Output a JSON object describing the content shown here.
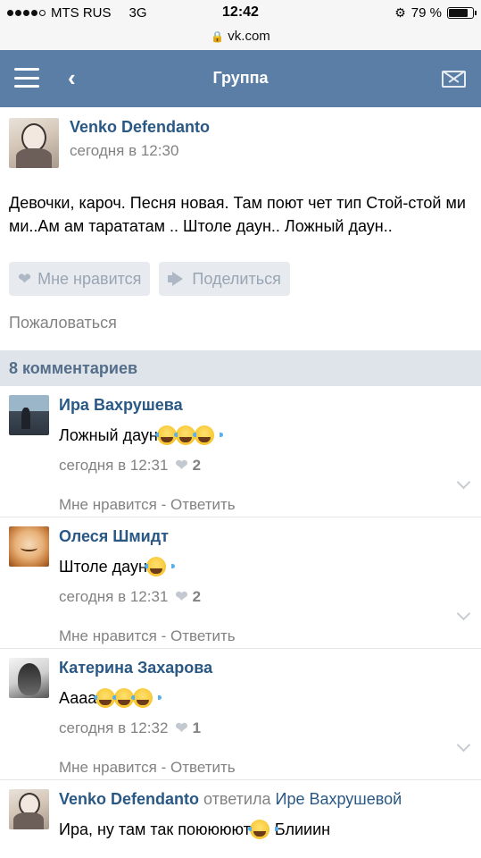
{
  "status_bar": {
    "carrier": "MTS RUS",
    "network": "3G",
    "time": "12:42",
    "battery": "79 %",
    "battery_level": 0.79,
    "url": "vk.com"
  },
  "navbar": {
    "title": "Группа",
    "menu_icon": "hamburger-icon",
    "back_icon": "chevron-left-icon",
    "mail_icon": "envelope-icon",
    "background": "#5b7ea6"
  },
  "post": {
    "author": "Venko Defendanto",
    "time": "сегодня в 12:30",
    "text": "Девочки, кароч. Песня новая. Там поют чет тип Стой-стой ми ми..Ам ам тарататам .. Штоле даун.. Ложный даун..",
    "like_label": "Мне нравится",
    "share_label": "Поделиться",
    "report_label": "Пожаловаться"
  },
  "comments_header": "8 комментариев",
  "comments": [
    {
      "author": "Ира Вахрушева",
      "text": "Ложный даун",
      "emoji_count": 3,
      "time": "сегодня в 12:31",
      "likes": "2",
      "like_label": "Мне нравится",
      "separator": " - ",
      "reply_label": "Ответить"
    },
    {
      "author": "Олеся Шмидт",
      "text": "Штоле даун",
      "emoji_count": 1,
      "time": "сегодня в 12:31",
      "likes": "2",
      "like_label": "Мне нравится",
      "separator": " - ",
      "reply_label": "Ответить"
    },
    {
      "author": "Катерина Захарова",
      "text": "Аааа",
      "emoji_count": 3,
      "time": "сегодня в 12:32",
      "likes": "1",
      "like_label": "Мне нравится",
      "separator": " - ",
      "reply_label": "Ответить"
    },
    {
      "author": "Venko Defendanto",
      "reply_verb": "ответила",
      "reply_to": "Ире Вахрушевой",
      "text_before": "Ира, ну там так поюююют",
      "text_after": "Блииин",
      "emoji_count": 1
    }
  ]
}
